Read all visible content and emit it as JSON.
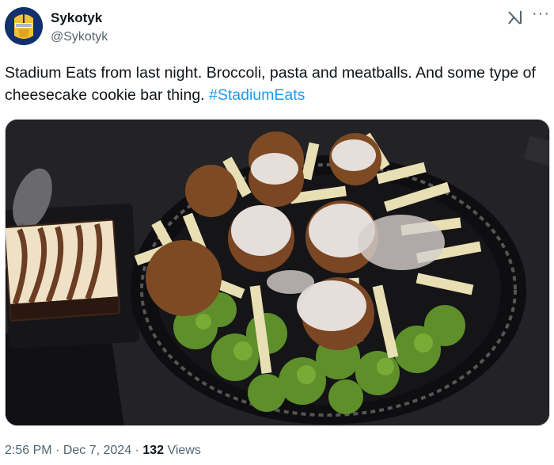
{
  "author": {
    "display_name": "Sykotyk",
    "handle": "@Sykotyk",
    "avatar_icon": "helmet-avatar-icon"
  },
  "header_icons": {
    "grok": "grok-icon",
    "more": "···"
  },
  "tweet": {
    "text": "Stadium Eats from last night. Broccoli, pasta and meatballs. And some type of cheesecake cookie bar thing. ",
    "hashtag": "#StadiumEats"
  },
  "media": {
    "alt": "Photo of a black plastic plate with broccoli, penne in white sauce and meatballs, next to a marbled cheesecake bar and a spoon"
  },
  "meta": {
    "time": "2:56 PM",
    "sep1": " · ",
    "date": "Dec 7, 2024",
    "sep2": " · ",
    "views_count": "132",
    "views_label": " Views"
  },
  "colors": {
    "link": "#1d9bf0",
    "secondary_text": "#536471",
    "avatar_bg": "#13306e"
  }
}
